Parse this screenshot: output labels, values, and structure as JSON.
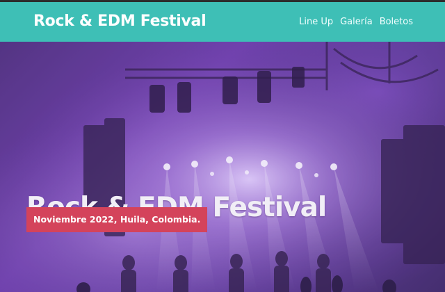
{
  "header": {
    "brand": "Rock & EDM Festival",
    "background_color": "#3ebfb6",
    "nav": [
      {
        "label": "Line Up"
      },
      {
        "label": "Galería"
      },
      {
        "label": "Boletos"
      }
    ]
  },
  "hero": {
    "title": "Rock & EDM Festival",
    "subtitle": "Noviembre 2022, Huila, Colombia.",
    "badge_color": "#d4435b"
  }
}
